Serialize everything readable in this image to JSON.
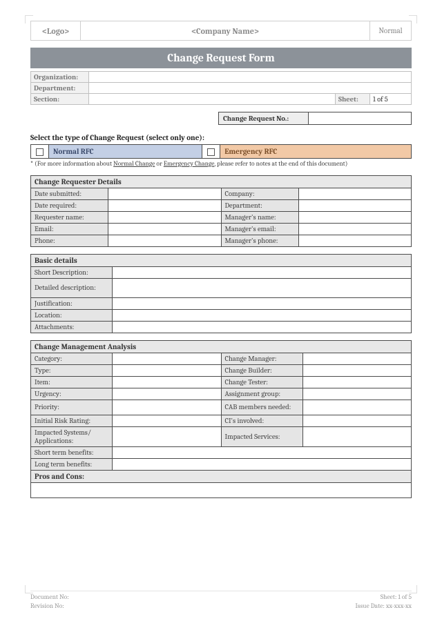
{
  "header": {
    "logo": "<Logo>",
    "company": "<Company Name>",
    "mode": "Normal"
  },
  "title": "Change Request Form",
  "org": {
    "organization_label": "Organization:",
    "organization_value": "",
    "department_label": "Department:",
    "department_value": "",
    "section_label": "Section:",
    "section_value": "",
    "sheet_label": "Sheet:",
    "sheet_value": "1 of 5"
  },
  "crn": {
    "label": "Change Request No.:",
    "value": ""
  },
  "select_prompt": "Select the type of Change Request (select only one):",
  "rfc": {
    "normal": "Normal RFC",
    "emergency": "Emergency RFC"
  },
  "footnote_pre": "* (For more information about ",
  "footnote_link1": "Normal Change",
  "footnote_mid": " or ",
  "footnote_link2": "Emergency Change",
  "footnote_post": ", please refer to notes at the end of this document)",
  "requester": {
    "header": "Change Requester Details",
    "date_submitted": "Date submitted:",
    "company": "Company:",
    "date_required": "Date required:",
    "department": "Department:",
    "requester_name": "Requester name:",
    "managers_name": "Manager's name:",
    "email": "Email:",
    "managers_email": "Manager's email:",
    "phone": "Phone:",
    "managers_phone": "Manager's phone:"
  },
  "basic": {
    "header": "Basic details",
    "short_desc": "Short Description:",
    "detailed_desc": "Detailed description:",
    "justification": "Justification:",
    "location": "Location:",
    "attachments": "Attachments:"
  },
  "cma": {
    "header": "Change Management Analysis",
    "category": "Category:",
    "change_manager": "Change Manager:",
    "type": "Type:",
    "change_builder": "Change Builder:",
    "item": "Item:",
    "change_tester": "Change Tester:",
    "urgency": "Urgency:",
    "assignment_group": "Assignment group:",
    "priority": "Priority:",
    "cab_members": "CAB members needed:",
    "initial_risk": "Initial Risk Rating:",
    "cis_involved": "CI's involved:",
    "impacted_systems": "Impacted Systems/ Applications:",
    "impacted_services": "Impacted Services:",
    "short_term": "Short term benefits:",
    "long_term": "Long term benefits:",
    "pros_cons": "Pros and Cons:"
  },
  "footer": {
    "doc_no": "Document No:",
    "rev_no": "Revision No:",
    "sheet": "Sheet: 1 of 5",
    "issue_date": "Issue Date: xx-xxx-xx"
  }
}
